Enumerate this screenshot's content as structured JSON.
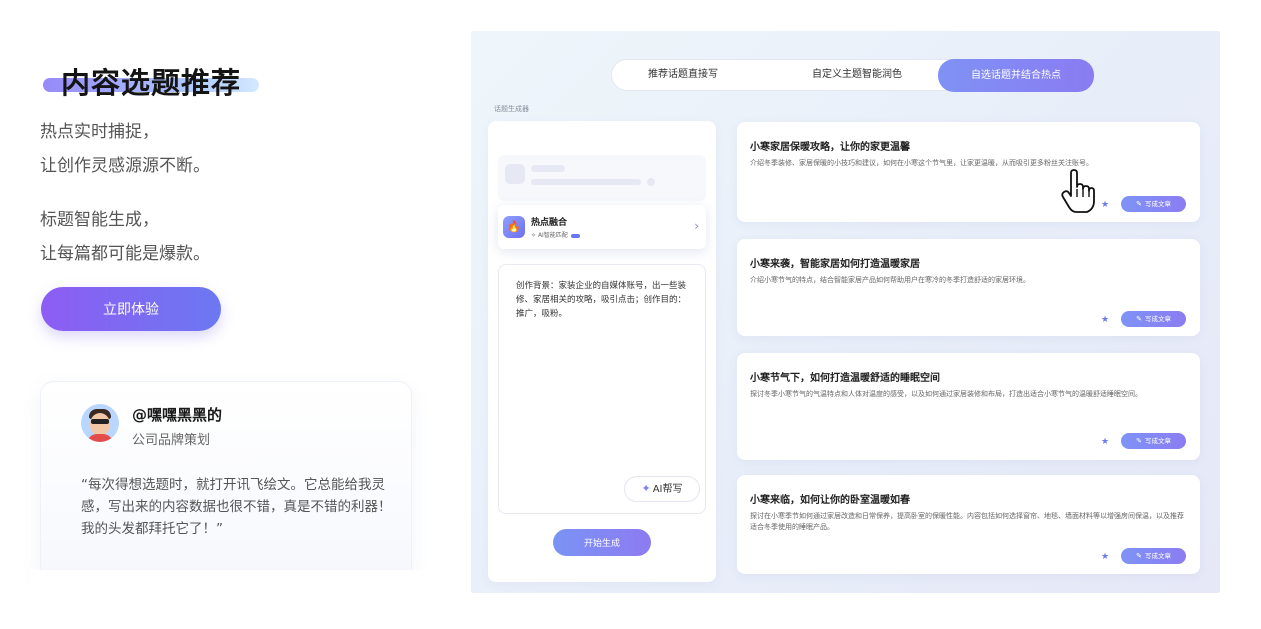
{
  "hero": {
    "title": "内容选题推荐",
    "line1": "热点实时捕捉，",
    "line2": "让创作灵感源源不断。",
    "line3": "标题智能生成，",
    "line4": "让每篇都可能是爆款。",
    "cta_label": "立即体验"
  },
  "testimonial": {
    "user_name": "@嘿嘿黑黑的",
    "user_role": "公司品牌策划",
    "quote": "“每次得想选题时，就打开讯飞绘文。它总能给我灵感，写出来的内容数据也很不错，真是不错的利器！我的头发都拜托它了！”"
  },
  "panel": {
    "tabs": [
      {
        "label": "推荐话题直接写",
        "active": false
      },
      {
        "label": "自定义主题智能润色",
        "active": false
      },
      {
        "label": "自选话题并结合热点",
        "active": true
      }
    ],
    "section_label": "话题生成器",
    "fusion": {
      "title": "热点融合",
      "subtitle": "AI智能匹配",
      "icon": "fire-icon"
    },
    "textarea_text": "创作背景：家装企业的自媒体账号，出一些装修、家居相关的攻略，吸引点击；创作目的：推广，吸粉。",
    "ai_help_label": "AI帮写",
    "start_label": "开始生成",
    "write_label": "写成文章",
    "topics": [
      {
        "title": "小寒家居保暖攻略，让你的家更温馨",
        "desc": "介绍冬季装修、家居保暖的小技巧和建议，如何在小寒这个节气里，让家更温暖，从而吸引更多粉丝关注账号。"
      },
      {
        "title": "小寒来袭，智能家居如何打造温暖家居",
        "desc": "介绍小寒节气的特点，结合智能家居产品如何帮助用户在寒冷的冬季打造舒适的家居环境。"
      },
      {
        "title": "小寒节气下，如何打造温暖舒适的睡眠空间",
        "desc": "探讨冬季小寒节气的气温特点和人体对温度的感受，以及如何通过家居装修和布局，打造出适合小寒节气的温暖舒适睡眠空间。"
      },
      {
        "title": "小寒来临，如何让你的卧室温暖如春",
        "desc": "探讨在小寒季节如何通过家居改造和日常保养，提高卧室的保暖性能。内容包括如何选择窗帘、地毯、墙面材料等以增强房间保温，以及推荐适合冬季使用的睡眠产品。"
      }
    ]
  },
  "colors": {
    "accent": "#7b7ff2",
    "cta_start": "#8d5df3",
    "cta_end": "#6c78f2"
  }
}
